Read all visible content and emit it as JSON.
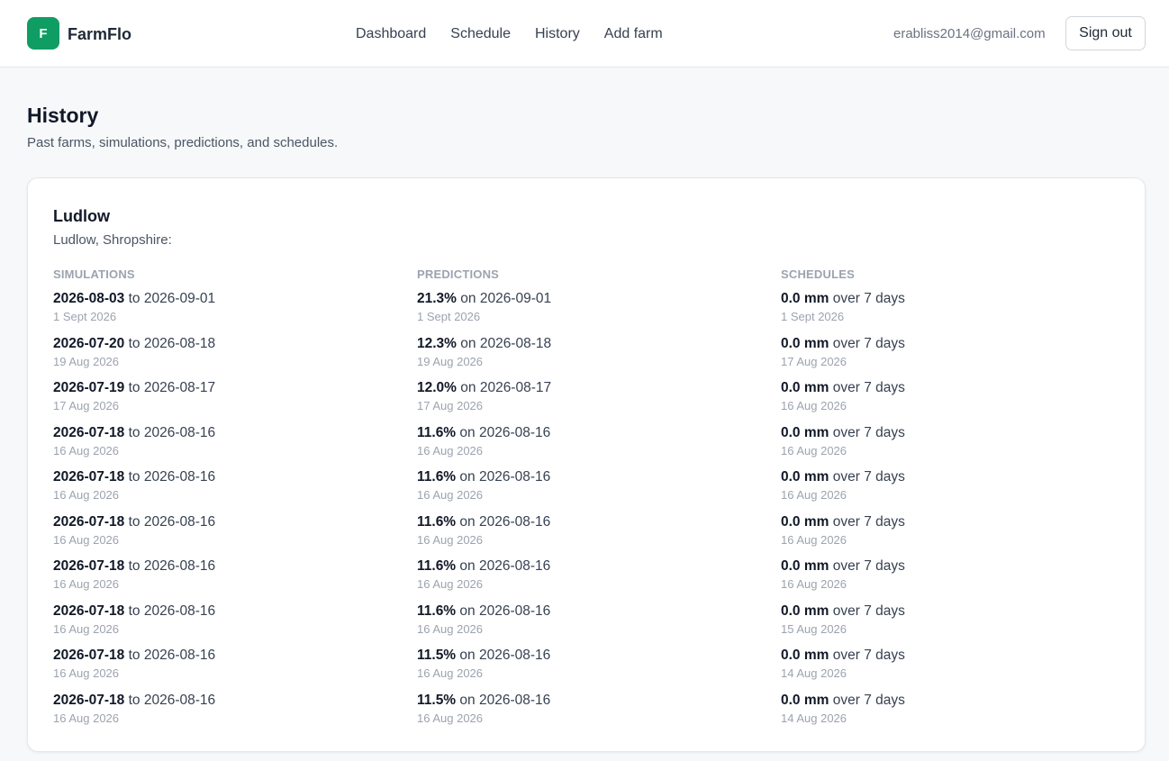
{
  "colors": {
    "brand_green": "#0f9d63",
    "background": "#f6f8fa",
    "card": "#ffffff",
    "muted_text": "#9ca3af"
  },
  "header": {
    "logo_letter": "F",
    "brand": "FarmFlo",
    "nav": [
      {
        "label": "Dashboard"
      },
      {
        "label": "Schedule"
      },
      {
        "label": "History"
      },
      {
        "label": "Add farm"
      }
    ],
    "user_email": "erabliss2014@gmail.com",
    "sign_out_label": "Sign out"
  },
  "page": {
    "title": "History",
    "subtitle": "Past farms, simulations, predictions, and schedules."
  },
  "farm": {
    "name": "Ludlow",
    "location": "Ludlow, Shropshire:",
    "simulations_header": "SIMULATIONS",
    "predictions_header": "PREDICTIONS",
    "schedules_header": "SCHEDULES",
    "simulations": [
      {
        "start": "2026-08-03",
        "sep": "to",
        "end": "2026-09-01",
        "date": "1 Sept 2026"
      },
      {
        "start": "2026-07-20",
        "sep": "to",
        "end": "2026-08-18",
        "date": "19 Aug 2026"
      },
      {
        "start": "2026-07-19",
        "sep": "to",
        "end": "2026-08-17",
        "date": "17 Aug 2026"
      },
      {
        "start": "2026-07-18",
        "sep": "to",
        "end": "2026-08-16",
        "date": "16 Aug 2026"
      },
      {
        "start": "2026-07-18",
        "sep": "to",
        "end": "2026-08-16",
        "date": "16 Aug 2026"
      },
      {
        "start": "2026-07-18",
        "sep": "to",
        "end": "2026-08-16",
        "date": "16 Aug 2026"
      },
      {
        "start": "2026-07-18",
        "sep": "to",
        "end": "2026-08-16",
        "date": "16 Aug 2026"
      },
      {
        "start": "2026-07-18",
        "sep": "to",
        "end": "2026-08-16",
        "date": "16 Aug 2026"
      },
      {
        "start": "2026-07-18",
        "sep": "to",
        "end": "2026-08-16",
        "date": "16 Aug 2026"
      },
      {
        "start": "2026-07-18",
        "sep": "to",
        "end": "2026-08-16",
        "date": "16 Aug 2026"
      }
    ],
    "predictions": [
      {
        "value": "21.3%",
        "sep": "on",
        "target": "2026-09-01",
        "date": "1 Sept 2026"
      },
      {
        "value": "12.3%",
        "sep": "on",
        "target": "2026-08-18",
        "date": "19 Aug 2026"
      },
      {
        "value": "12.0%",
        "sep": "on",
        "target": "2026-08-17",
        "date": "17 Aug 2026"
      },
      {
        "value": "11.6%",
        "sep": "on",
        "target": "2026-08-16",
        "date": "16 Aug 2026"
      },
      {
        "value": "11.6%",
        "sep": "on",
        "target": "2026-08-16",
        "date": "16 Aug 2026"
      },
      {
        "value": "11.6%",
        "sep": "on",
        "target": "2026-08-16",
        "date": "16 Aug 2026"
      },
      {
        "value": "11.6%",
        "sep": "on",
        "target": "2026-08-16",
        "date": "16 Aug 2026"
      },
      {
        "value": "11.6%",
        "sep": "on",
        "target": "2026-08-16",
        "date": "16 Aug 2026"
      },
      {
        "value": "11.5%",
        "sep": "on",
        "target": "2026-08-16",
        "date": "16 Aug 2026"
      },
      {
        "value": "11.5%",
        "sep": "on",
        "target": "2026-08-16",
        "date": "16 Aug 2026"
      }
    ],
    "schedules": [
      {
        "amount": "0.0 mm",
        "period": "over 7 days",
        "date": "1 Sept 2026"
      },
      {
        "amount": "0.0 mm",
        "period": "over 7 days",
        "date": "17 Aug 2026"
      },
      {
        "amount": "0.0 mm",
        "period": "over 7 days",
        "date": "16 Aug 2026"
      },
      {
        "amount": "0.0 mm",
        "period": "over 7 days",
        "date": "16 Aug 2026"
      },
      {
        "amount": "0.0 mm",
        "period": "over 7 days",
        "date": "16 Aug 2026"
      },
      {
        "amount": "0.0 mm",
        "period": "over 7 days",
        "date": "16 Aug 2026"
      },
      {
        "amount": "0.0 mm",
        "period": "over 7 days",
        "date": "16 Aug 2026"
      },
      {
        "amount": "0.0 mm",
        "period": "over 7 days",
        "date": "15 Aug 2026"
      },
      {
        "amount": "0.0 mm",
        "period": "over 7 days",
        "date": "14 Aug 2026"
      },
      {
        "amount": "0.0 mm",
        "period": "over 7 days",
        "date": "14 Aug 2026"
      }
    ]
  }
}
